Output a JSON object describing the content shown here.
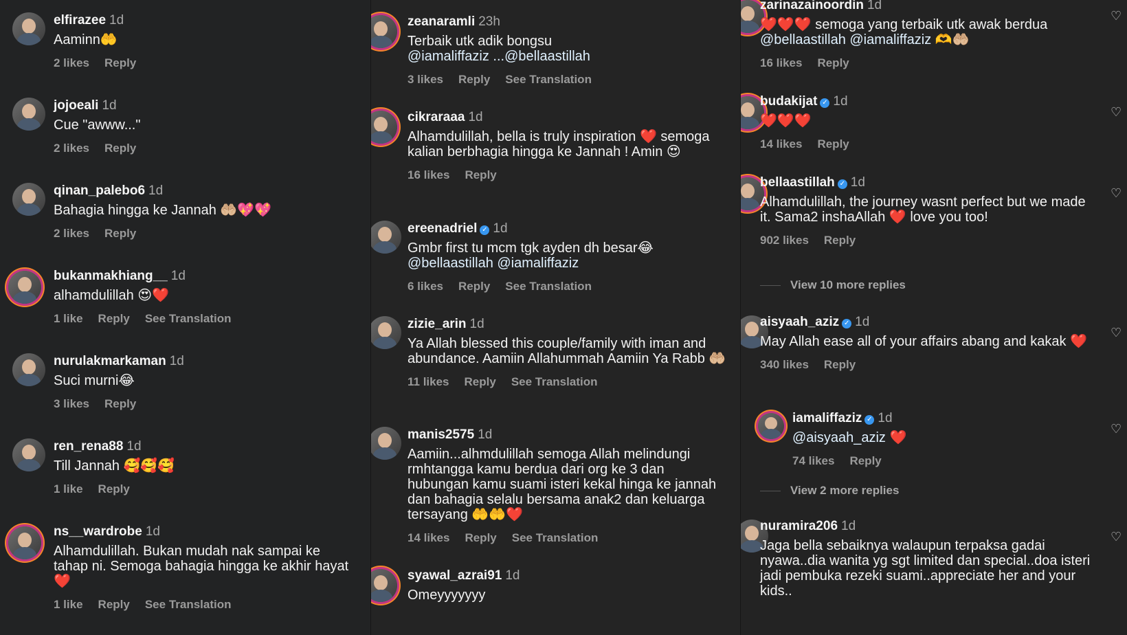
{
  "columns": [
    {
      "comments": [
        {
          "username": "elfirazee",
          "time": "1d",
          "text": "Aaminn🤲",
          "likes": "2 likes",
          "reply": "Reply"
        },
        {
          "username": "jojoeali",
          "time": "1d",
          "text": "Cue \"awww...\"",
          "likes": "2 likes",
          "reply": "Reply"
        },
        {
          "username": "qinan_palebo6",
          "time": "1d",
          "text": "Bahagia hingga ke Jannah 🤲🏼💖💖",
          "likes": "2 likes",
          "reply": "Reply"
        },
        {
          "username": "bukanmakhiang__",
          "time": "1d",
          "text": "alhamdulillah 😍❤️",
          "likes": "1 like",
          "reply": "Reply",
          "translation": "See Translation"
        },
        {
          "username": "nurulakmarkaman",
          "time": "1d",
          "text": "Suci murni😂",
          "likes": "3 likes",
          "reply": "Reply"
        },
        {
          "username": "ren_rena88",
          "time": "1d",
          "text": "Till Jannah 🥰🥰🥰",
          "likes": "1 like",
          "reply": "Reply"
        },
        {
          "username": "ns__wardrobe",
          "time": "1d",
          "text": "Alhamdulillah. Bukan mudah nak sampai ke tahap ni. Semoga bahagia hingga ke akhir hayat❤️",
          "likes": "1 like",
          "reply": "Reply",
          "translation": "See Translation"
        }
      ]
    },
    {
      "comments": [
        {
          "username": "zeanaramli",
          "time": "23h",
          "text": "Terbaik utk adik bongsu",
          "mention": "@iamaliffaziz ...@bellaastillah",
          "likes": "3 likes",
          "reply": "Reply",
          "translation": "See Translation"
        },
        {
          "username": "cikraraaa",
          "time": "1d",
          "text": "Alhamdulillah, bella is truly inspiration ❤️ semoga kalian berbhagia hingga ke Jannah ! Amin 😍",
          "likes": "16 likes",
          "reply": "Reply"
        },
        {
          "username": "ereenadriel",
          "time": "1d",
          "verified": "✓",
          "text": "Gmbr first tu mcm tgk ayden dh besar😂",
          "mention": "@bellaastillah @iamaliffaziz",
          "likes": "6 likes",
          "reply": "Reply",
          "translation": "See Translation"
        },
        {
          "username": "zizie_arin",
          "time": "1d",
          "text": "Ya Allah blessed this couple/family with iman and abundance.  Aamiin Allahummah Aamiin Ya Rabb 🤲🏼",
          "likes": "11 likes",
          "reply": "Reply",
          "translation": "See Translation"
        },
        {
          "username": "manis2575",
          "time": "1d",
          "text": "Aamiin...alhmdulillah semoga Allah melindungi rmhtangga kamu berdua dari org ke 3 dan hubungan kamu suami isteri kekal hinga ke jannah dan bahagia selalu bersama anak2 dan keluarga tersayang 🤲🤲❤️",
          "likes": "14 likes",
          "reply": "Reply",
          "translation": "See Translation"
        },
        {
          "username": "syawal_azrai91",
          "time": "1d",
          "text": "Omeyyyyyyy"
        }
      ]
    },
    {
      "comments": [
        {
          "username": "zarinazainoordin",
          "time": "1d",
          "text": "❤️❤️❤️ semoga yang terbaik utk awak berdua",
          "mention": "@bellaastillah @iamaliffaziz 🫶🤲🏼",
          "likes": "16 likes",
          "reply": "Reply"
        },
        {
          "username": "budakijat",
          "time": "1d",
          "verified": "✓",
          "text": "❤️❤️❤️",
          "likes": "14 likes",
          "reply": "Reply"
        },
        {
          "username": "bellaastillah",
          "time": "1d",
          "verified": "✓",
          "text": "Alhamdulillah, the journey wasnt perfect but we made it. Sama2 inshaAllah ❤️ love you too!",
          "likes": "902 likes",
          "reply": "Reply",
          "view_more": "View 10 more replies"
        },
        {
          "username": "aisyaah_aziz",
          "time": "1d",
          "verified": "✓",
          "text": "May Allah ease all of your affairs abang and kakak ❤️",
          "likes": "340 likes",
          "reply": "Reply"
        },
        {
          "username": "iamaliffaziz",
          "time": "1d",
          "verified": "✓",
          "text": "",
          "mention": "@aisyaah_aziz ❤️",
          "likes": "74 likes",
          "reply": "Reply",
          "view_more": "View 2 more replies"
        },
        {
          "username": "nuramira206",
          "time": "1d",
          "text": "Jaga bella sebaiknya walaupun terpaksa gadai nyawa..dia wanita yg sgt limited dan special..doa isteri jadi pembuka rezeki suami..appreciate her and your kids.."
        }
      ]
    }
  ],
  "icons": {
    "like": "heart-outline-icon",
    "verified": "verified-badge-icon"
  },
  "colors": {
    "background": "#1f1f1f",
    "mention": "#e0f1ff",
    "verified": "#3897f0",
    "meta": "#9a9a9a"
  }
}
